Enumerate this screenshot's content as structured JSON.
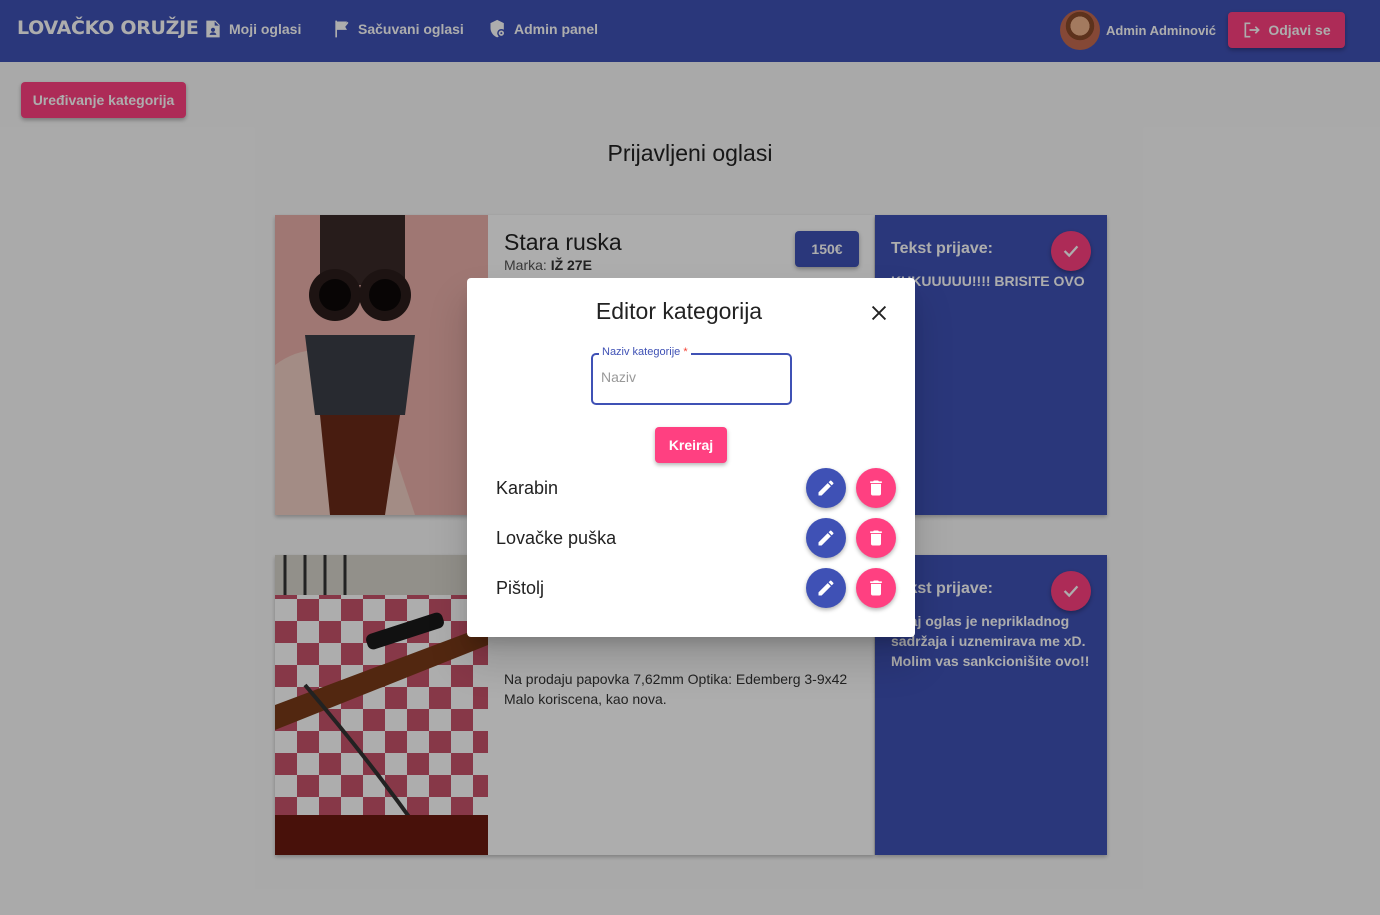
{
  "header": {
    "brand": "LOVAČKO ORUŽJE",
    "nav": [
      {
        "label": "Moji oglasi",
        "icon": "document-person-icon"
      },
      {
        "label": "Sačuvani oglasi",
        "icon": "bookmark-check-icon"
      },
      {
        "label": "Admin panel",
        "icon": "shield-gear-icon"
      }
    ],
    "user_name": "Admin Adminović",
    "logout_label": "Odjavi se"
  },
  "toolbar": {
    "edit_categories_label": "Uređivanje kategorija"
  },
  "page_title": "Prijavljeni oglasi",
  "ads": [
    {
      "title": "Stara ruska",
      "brand_label": "Marka:",
      "brand_value": "IŽ 27E",
      "price": "150€",
      "description": "",
      "report_label": "Tekst prijave:",
      "report_text": "KUKUUUUU!!!! BRISITE OVO"
    },
    {
      "title": "",
      "brand_label": "",
      "brand_value": "",
      "price": "",
      "description": "Na prodaju papovka 7,62mm Optika: Edemberg 3-9x42 Malo koriscena, kao nova.",
      "report_label": "Tekst prijave:",
      "report_text": "Ovaj oglas je neprikladnog sadržaja i uznemirava me xD. Molim vas sankcionišite ovo!!"
    }
  ],
  "dialog": {
    "title": "Editor kategorija",
    "field_label": "Naziv kategorije",
    "required_mark": "*",
    "field_placeholder": "Naziv",
    "field_value": "",
    "create_label": "Kreiraj",
    "categories": [
      {
        "name": "Karabin"
      },
      {
        "name": "Lovačke puška"
      },
      {
        "name": "Pištolj"
      }
    ]
  },
  "colors": {
    "primary": "#3f51b5",
    "accent": "#ff4081"
  }
}
